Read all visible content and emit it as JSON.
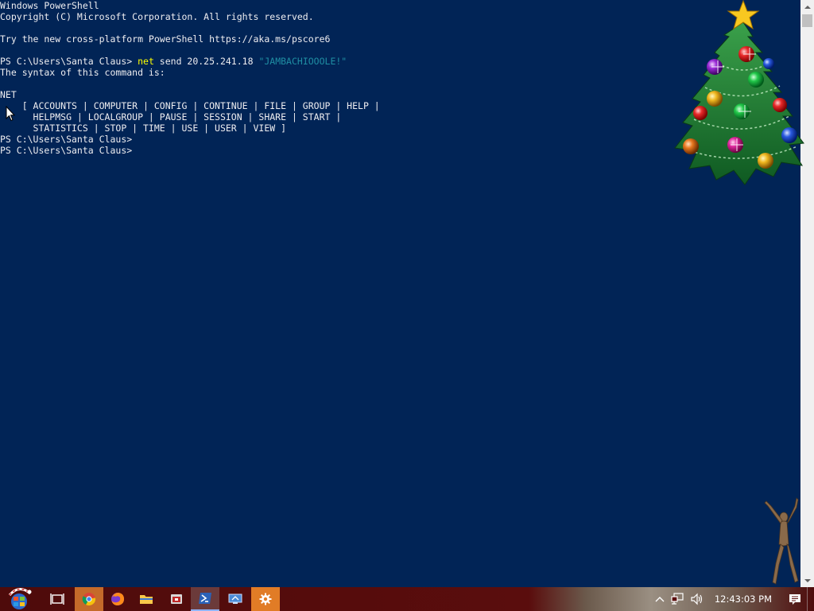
{
  "console": {
    "lines": {
      "l1": "Windows PowerShell",
      "l2": "Copyright (C) Microsoft Corporation. All rights reserved.",
      "l3": "",
      "l4": "Try the new cross-platform PowerShell https://aka.ms/pscore6",
      "l5": "",
      "l6_prompt": "PS C:\\Users\\Santa Claus> ",
      "l6_cmd": "net",
      "l6_args": " send 20.25.241.18 ",
      "l6_string": "\"JAMBACHIOOOLE!\"",
      "l7": "The syntax of this command is:",
      "l8": "",
      "l9": "NET",
      "l10": "    [ ACCOUNTS | COMPUTER | CONFIG | CONTINUE | FILE | GROUP | HELP |",
      "l11": "      HELPMSG | LOCALGROUP | PAUSE | SESSION | SHARE | START |",
      "l12": "      STATISTICS | STOP | TIME | USE | USER | VIEW ]",
      "l13": "PS C:\\Users\\Santa Claus>",
      "l14": "PS C:\\Users\\Santa Claus>"
    }
  },
  "colors": {
    "console_background": "#012456",
    "console_foreground": "#eeedf0",
    "command": "#ffff00",
    "string": "#1f8ea3",
    "taskbar": "#5a0d0d"
  },
  "taskbar": {
    "icons": {
      "start": "windows-start-icon",
      "task_view": "task-view-icon",
      "chrome": "chrome-icon",
      "firefox": "firefox-icon",
      "file_explorer": "folder-icon",
      "app": "app-icon",
      "powershell": "powershell-icon",
      "remote": "remote-desktop-icon",
      "settings": "gear-icon"
    },
    "tray": {
      "clock": "12:43:03 PM"
    }
  }
}
